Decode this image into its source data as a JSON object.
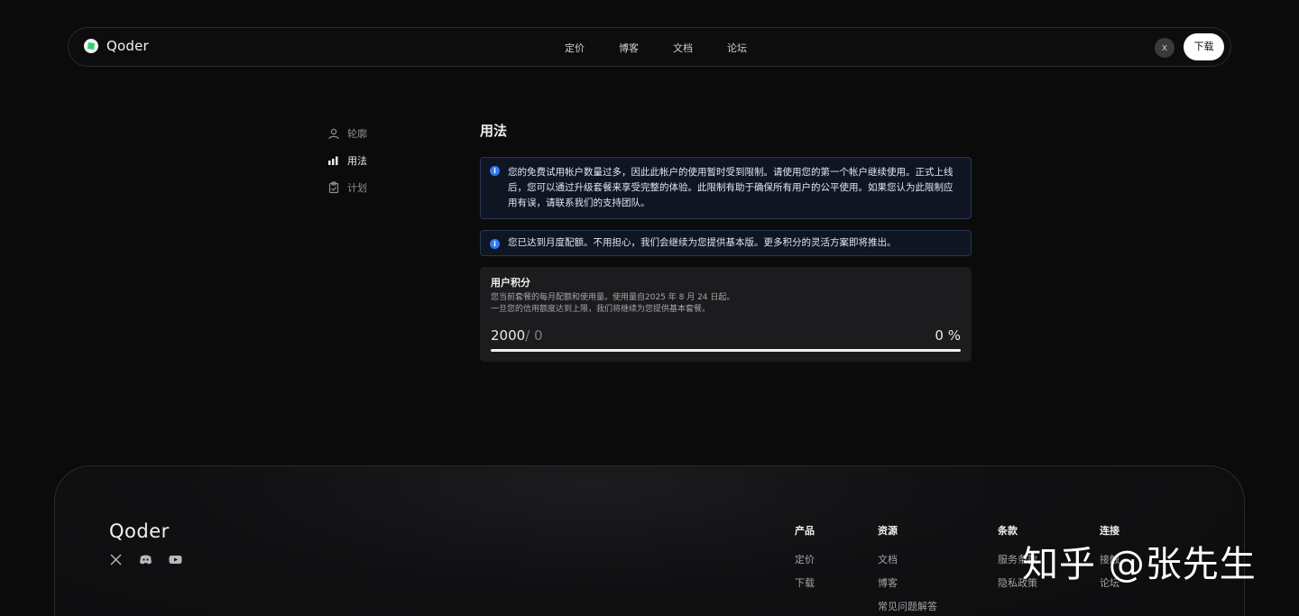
{
  "header": {
    "brand": "Qoder",
    "nav": [
      "定价",
      "博客",
      "文档",
      "论坛"
    ],
    "close_label": "x",
    "download_label": "下载"
  },
  "sidebar": {
    "items": [
      {
        "label": "轮廓",
        "icon": "user-icon",
        "active": false
      },
      {
        "label": "用法",
        "icon": "bar-chart-icon",
        "active": true
      },
      {
        "label": "计划",
        "icon": "clipboard-icon",
        "active": false
      }
    ]
  },
  "main": {
    "title": "用法",
    "alert1": "您的免费试用帐户数量过多，因此此帐户的使用暂时受到限制。请使用您的第一个帐户继续使用。正式上线后，您可以通过升级套餐来享受完整的体验。此限制有助于确保所有用户的公平使用。如果您认为此限制应用有误，请联系我们的支持团队。",
    "alert2": "您已达到月度配额。不用担心，我们会继续为您提供基本版。更多积分的灵活方案即将推出。",
    "credits": {
      "title": "用户积分",
      "desc1": "您当前套餐的每月配额和使用量。使用量自2025 年 8 月 24 日起。",
      "desc2": "一旦您的信用额度达到上限，我们将继续为您提供基本套餐。",
      "used": "2000",
      "total": "/ 0",
      "percent_label": "0 %",
      "percent": 0
    }
  },
  "footer": {
    "brand": "Qoder",
    "social": [
      "x-icon",
      "discord-icon",
      "youtube-icon"
    ],
    "columns": [
      {
        "title": "产品",
        "links": [
          "定价",
          "下载"
        ]
      },
      {
        "title": "资源",
        "links": [
          "文档",
          "博客",
          "常见问题解答"
        ]
      },
      {
        "title": "条款",
        "links": [
          "服务条款",
          "隐私政策"
        ]
      },
      {
        "title": "连接",
        "links": [
          "接触",
          "论坛"
        ]
      }
    ]
  },
  "watermark": "知乎 @张先生",
  "colors": {
    "accent": "#2f7af5",
    "background": "#0b0b0c",
    "alert_bg": "#0f1523",
    "alert_border": "#263650"
  }
}
